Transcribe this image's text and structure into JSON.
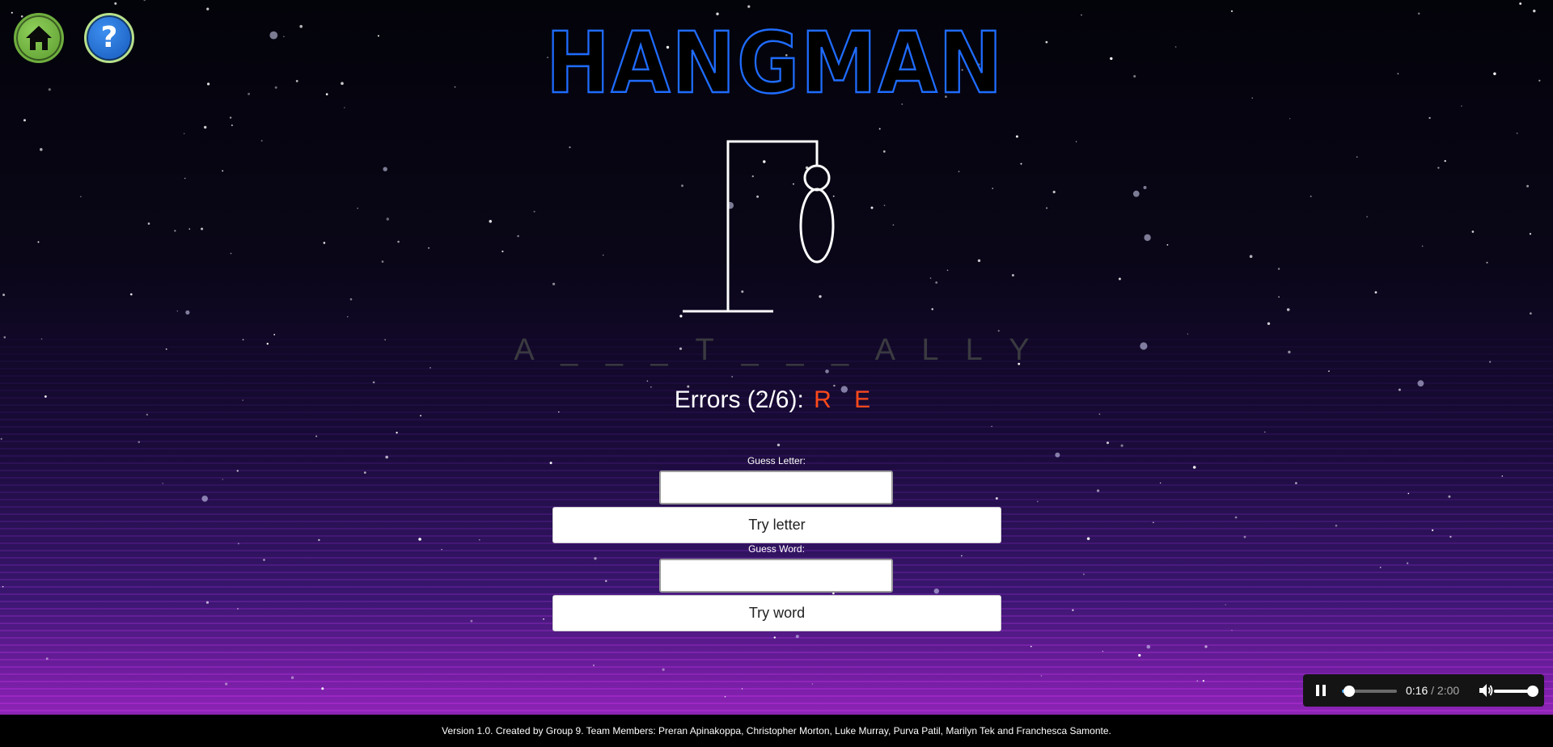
{
  "header": {
    "home_icon": "home-icon",
    "help_icon": "help-icon",
    "help_glyph": "?",
    "title": "HANGMAN"
  },
  "game": {
    "word_display": "A _ _ _ T _ _ _ A L L Y",
    "errors_label": "Errors (2/6):",
    "wrong_letters": "R E",
    "guess_letter_label": "Guess Letter:",
    "guess_letter_value": "",
    "try_letter_label": "Try letter",
    "guess_word_label": "Guess Word:",
    "guess_word_value": "",
    "try_word_label": "Try word"
  },
  "player": {
    "current_time": "0:16",
    "separator": " / ",
    "duration": "2:00",
    "progress": 0.133,
    "volume": 1.0
  },
  "footer": {
    "text": "Version 1.0. Created by Group 9. Team Members: Preran Apinakoppa, Christopher Morton, Luke Murray, Purva Patil, Marilyn Tek and Franchesca Samonte."
  },
  "colors": {
    "title_stroke": "#1f6cff",
    "error_letters": "#ff4a1a",
    "home_button": "#6fae3e",
    "help_button": "#1f6cff"
  }
}
